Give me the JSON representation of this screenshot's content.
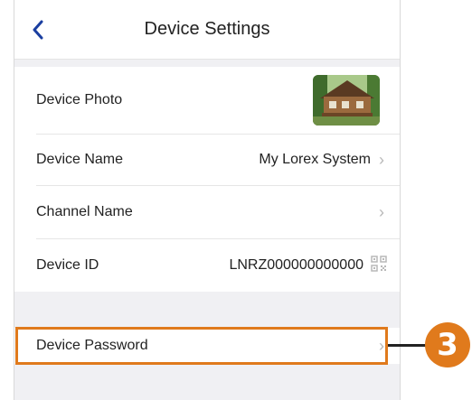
{
  "header": {
    "title": "Device Settings",
    "back_icon": "chevron-left-icon"
  },
  "rows": {
    "photo": {
      "label": "Device Photo"
    },
    "name": {
      "label": "Device Name",
      "value": "My Lorex System"
    },
    "channel": {
      "label": "Channel Name",
      "value": ""
    },
    "id": {
      "label": "Device ID",
      "value": "LNRZ000000000000"
    },
    "password": {
      "label": "Device Password"
    }
  },
  "callout": {
    "number": "3"
  },
  "colors": {
    "accent": "#1a3ea0",
    "highlight": "#e07a1c",
    "chevron": "#b8b8b8"
  }
}
